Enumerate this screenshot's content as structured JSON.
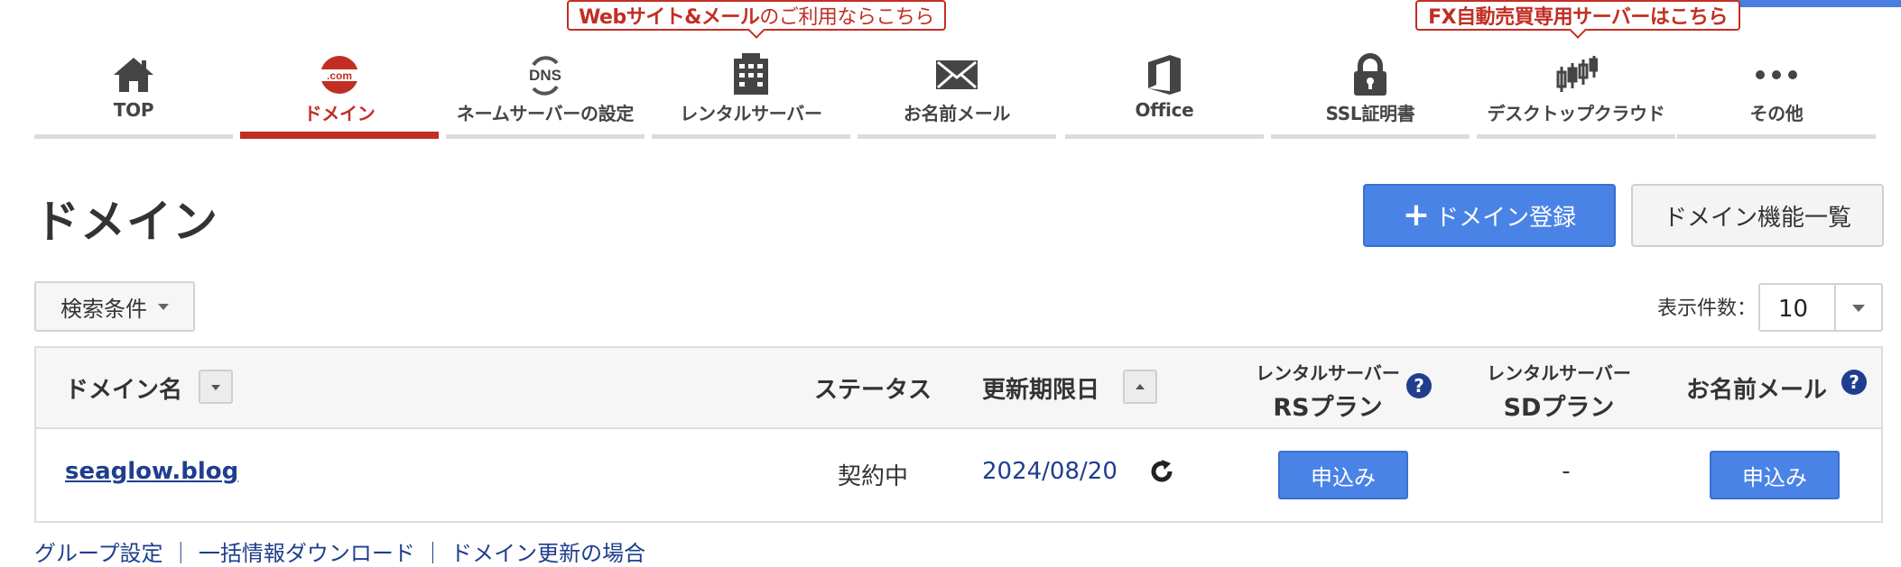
{
  "promos": {
    "web_mail": {
      "bold": "Webサイト&メール",
      "rest": "のご利用ならこちら"
    },
    "fx": "FX自動売買専用サーバーはこちら"
  },
  "nav": {
    "items": [
      {
        "label": "TOP",
        "icon": "home-icon"
      },
      {
        "label": "ドメイン",
        "icon": "dotcom-icon",
        "icon_text": ".com",
        "active": true
      },
      {
        "label": "ネームサーバーの設定",
        "icon": "dns-icon",
        "icon_text": "DNS"
      },
      {
        "label": "レンタルサーバー",
        "icon": "server-icon"
      },
      {
        "label": "お名前メール",
        "icon": "mail-icon"
      },
      {
        "label": "Office",
        "icon": "office-icon"
      },
      {
        "label": "SSL証明書",
        "icon": "lock-icon"
      },
      {
        "label": "デスクトップクラウド",
        "icon": "candlestick-icon"
      },
      {
        "label": "その他",
        "icon": "more-icon"
      }
    ]
  },
  "page": {
    "title": "ドメイン",
    "register_button": "ドメイン登録",
    "functions_button": "ドメイン機能一覧",
    "search_conditions": "検索条件",
    "per_page_label": "表示件数：",
    "per_page_value": "10"
  },
  "table": {
    "headers": {
      "domain": "ドメイン名",
      "status": "ステータス",
      "expiry": "更新期限日",
      "rs_top": "レンタルサーバー",
      "rs_bottom": "RSプラン",
      "sd_top": "レンタルサーバー",
      "sd_bottom": "SDプラン",
      "mail": "お名前メール"
    },
    "rows": [
      {
        "domain": "seaglow.blog",
        "status": "契約中",
        "expiry": "2024/08/20",
        "rs": "申込み",
        "sd": "-",
        "mail": "申込み"
      }
    ]
  },
  "footer": {
    "links_text": "グループ設定 ｜ 一括情報ダウンロード ｜ ドメイン更新の場合"
  },
  "colors": {
    "brand_red": "#c22e23",
    "primary_blue": "#4a83e6",
    "link_navy": "#1f3e8e"
  }
}
